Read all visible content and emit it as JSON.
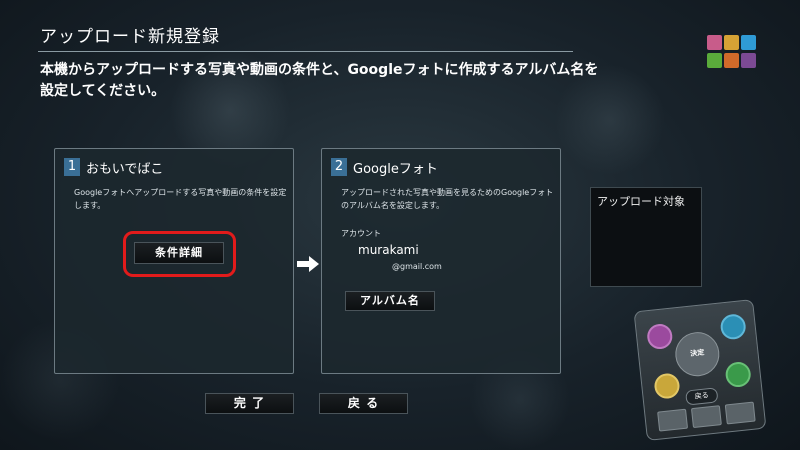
{
  "header": {
    "title": "アップロード新規登録",
    "description": "本機からアップロードする写真や動画の条件と、Googleフォトに作成するアルバム名を設定してください。"
  },
  "logo_colors": [
    "#c85c8a",
    "#d6a235",
    "#2f9bd6",
    "#5aab3b",
    "#d06a2a",
    "#7c4a94"
  ],
  "panel1": {
    "number": "1",
    "title": "おもいでばこ",
    "text": "Googleフォトへアップロードする写真や動画の条件を設定します。",
    "button": "条件詳細"
  },
  "panel2": {
    "number": "2",
    "title": "Googleフォト",
    "text": "アップロードされた写真や動画を見るためのGoogleフォトのアルバム名を設定します。",
    "account_label": "アカウント",
    "account_name": "murakami",
    "account_email": "@gmail.com",
    "button": "アルバム名"
  },
  "side": {
    "label": "アップロード対象"
  },
  "footer": {
    "done": "完 了",
    "back": "戻 る"
  },
  "remote": {
    "center": "決定",
    "back": "戻る",
    "button_colors": [
      "#9b4a9e",
      "#2b8fb5",
      "#c9a73a",
      "#3a9a4a"
    ]
  },
  "highlight_color": "#e21b1b"
}
